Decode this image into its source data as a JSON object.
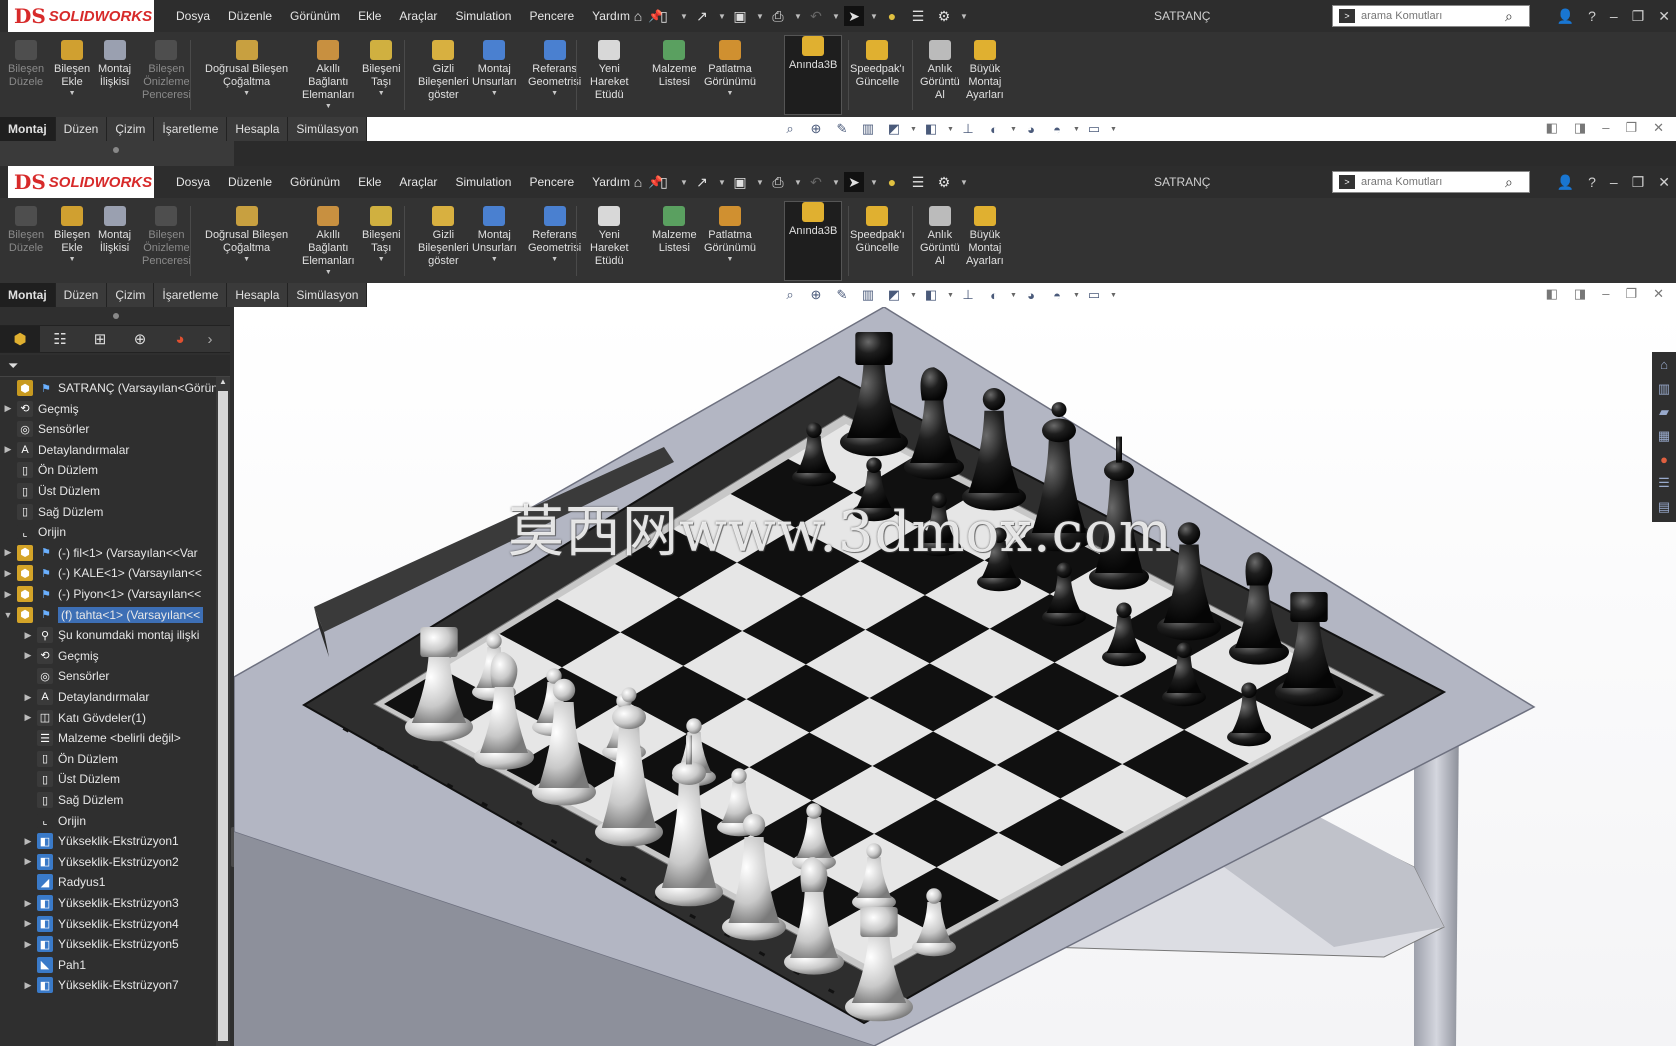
{
  "app": {
    "brand_ds": "DS",
    "brand_name": "SOLIDWORKS",
    "doc_title": "SATRANÇ"
  },
  "menu": [
    "Dosya",
    "Düzenle",
    "Görünüm",
    "Ekle",
    "Araçlar",
    "Simulation",
    "Pencere",
    "Yardım"
  ],
  "search": {
    "placeholder": "arama Komutları"
  },
  "ribbon": [
    {
      "label": "Bileşen\nDüzele",
      "disabled": true,
      "icon": "edit-component-icon"
    },
    {
      "label": "Bileşen\nEkle",
      "disabled": false,
      "icon": "insert-component-icon"
    },
    {
      "label": "Montaj\nİlişkisi",
      "disabled": false,
      "icon": "mate-icon"
    },
    {
      "label": "Bileşen\nÖnizleme\nPenceresi",
      "disabled": true,
      "icon": "preview-window-icon"
    },
    {
      "label": "Doğrusal Bileşen\nÇoğaltma",
      "disabled": false,
      "icon": "linear-pattern-icon"
    },
    {
      "label": "Akıllı\nBağlantı\nElemanları",
      "disabled": false,
      "icon": "smart-fasteners-icon"
    },
    {
      "label": "Bileşeni\nTaşı",
      "disabled": false,
      "icon": "move-component-icon"
    },
    {
      "label": "Gizli\nBileşenleri\ngöster",
      "disabled": false,
      "icon": "show-hidden-icon"
    },
    {
      "label": "Montaj\nUnsurları",
      "disabled": false,
      "icon": "assembly-features-icon"
    },
    {
      "label": "Referans\nGeometrisi",
      "disabled": false,
      "icon": "reference-geometry-icon"
    },
    {
      "label": "Yeni\nHareket\nEtüdü",
      "disabled": false,
      "icon": "motion-study-icon"
    },
    {
      "label": "Malzeme\nListesi",
      "disabled": false,
      "icon": "bom-icon"
    },
    {
      "label": "Patlatma\nGörünümü",
      "disabled": false,
      "icon": "explode-view-icon"
    },
    {
      "label": "Anında3B",
      "disabled": false,
      "icon": "instant3d-icon"
    },
    {
      "label": "Speedpak'ı\nGüncelle",
      "disabled": false,
      "icon": "speedpak-icon"
    },
    {
      "label": "Anlık\nGörüntü\nAl",
      "disabled": false,
      "icon": "snapshot-icon"
    },
    {
      "label": "Büyük\nMontaj\nAyarları",
      "disabled": false,
      "icon": "large-assembly-icon"
    }
  ],
  "tabs": [
    "Montaj",
    "Düzen",
    "Çizim",
    "İşaretleme",
    "Hesapla",
    "Simülasyon"
  ],
  "tree": [
    {
      "label": "SATRANÇ  (Varsayılan<Görüntü",
      "level": 0,
      "arrow": "",
      "icon": "assembly-icon"
    },
    {
      "label": "Geçmiş",
      "level": 1,
      "arrow": "▶",
      "icon": "history-icon"
    },
    {
      "label": "Sensörler",
      "level": 1,
      "arrow": "",
      "icon": "sensor-icon"
    },
    {
      "label": "Detaylandırmalar",
      "level": 1,
      "arrow": "▶",
      "icon": "annotations-icon"
    },
    {
      "label": "Ön Düzlem",
      "level": 1,
      "arrow": "",
      "icon": "plane-icon"
    },
    {
      "label": "Üst Düzlem",
      "level": 1,
      "arrow": "",
      "icon": "plane-icon"
    },
    {
      "label": "Sağ Düzlem",
      "level": 1,
      "arrow": "",
      "icon": "plane-icon"
    },
    {
      "label": "Orijin",
      "level": 1,
      "arrow": "",
      "icon": "origin-icon"
    },
    {
      "label": "(-) fil<1> (Varsayılan<<Var",
      "level": 1,
      "arrow": "▶",
      "icon": "part-icon"
    },
    {
      "label": "(-) KALE<1> (Varsayılan<<",
      "level": 1,
      "arrow": "▶",
      "icon": "part-icon"
    },
    {
      "label": "(-) Piyon<1> (Varsayılan<<",
      "level": 1,
      "arrow": "▶",
      "icon": "part-icon"
    },
    {
      "label": "(f) tahta<1> (Varsayılan<<",
      "level": 1,
      "arrow": "▼",
      "icon": "part-icon",
      "selected": true
    },
    {
      "label": "Şu konumdaki montaj ilişki",
      "level": 2,
      "arrow": "▶",
      "icon": "mates-icon"
    },
    {
      "label": "Geçmiş",
      "level": 2,
      "arrow": "▶",
      "icon": "history-icon"
    },
    {
      "label": "Sensörler",
      "level": 2,
      "arrow": "",
      "icon": "sensor-icon"
    },
    {
      "label": "Detaylandırmalar",
      "level": 2,
      "arrow": "▶",
      "icon": "annotations-icon"
    },
    {
      "label": "Katı Gövdeler(1)",
      "level": 2,
      "arrow": "▶",
      "icon": "solid-bodies-icon"
    },
    {
      "label": "Malzeme <belirli değil>",
      "level": 2,
      "arrow": "",
      "icon": "material-icon"
    },
    {
      "label": "Ön Düzlem",
      "level": 2,
      "arrow": "",
      "icon": "plane-icon"
    },
    {
      "label": "Üst Düzlem",
      "level": 2,
      "arrow": "",
      "icon": "plane-icon"
    },
    {
      "label": "Sağ Düzlem",
      "level": 2,
      "arrow": "",
      "icon": "plane-icon"
    },
    {
      "label": "Orijin",
      "level": 2,
      "arrow": "",
      "icon": "origin-icon"
    },
    {
      "label": "Yükseklik-Ekstrüzyon1",
      "level": 2,
      "arrow": "▶",
      "icon": "extrude-icon"
    },
    {
      "label": "Yükseklik-Ekstrüzyon2",
      "level": 2,
      "arrow": "▶",
      "icon": "extrude-icon"
    },
    {
      "label": "Radyus1",
      "level": 2,
      "arrow": "",
      "icon": "fillet-icon"
    },
    {
      "label": "Yükseklik-Ekstrüzyon3",
      "level": 2,
      "arrow": "▶",
      "icon": "extrude-icon"
    },
    {
      "label": "Yükseklik-Ekstrüzyon4",
      "level": 2,
      "arrow": "▶",
      "icon": "extrude-icon"
    },
    {
      "label": "Yükseklik-Ekstrüzyon5",
      "level": 2,
      "arrow": "▶",
      "icon": "extrude-icon"
    },
    {
      "label": "Pah1",
      "level": 2,
      "arrow": "",
      "icon": "chamfer-icon"
    },
    {
      "label": "Yükseklik-Ekstrüzyon7",
      "level": 2,
      "arrow": "▶",
      "icon": "extrude-icon"
    }
  ],
  "watermark": "莫西网www.3dmox.com",
  "colors": {
    "brand": "#d72a2a",
    "chrome": "#2b2b2b",
    "selection": "#3d6fb5"
  }
}
